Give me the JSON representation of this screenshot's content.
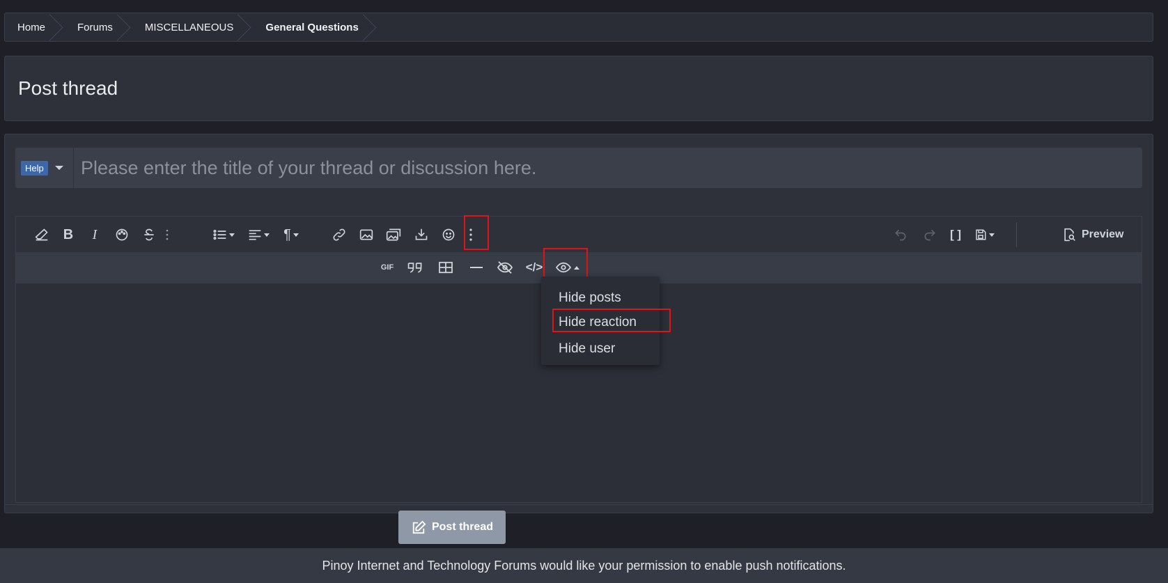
{
  "breadcrumb": {
    "items": [
      {
        "label": "Home"
      },
      {
        "label": "Forums"
      },
      {
        "label": "MISCELLANEOUS"
      },
      {
        "label": "General Questions"
      }
    ]
  },
  "page": {
    "title": "Post thread"
  },
  "thread_form": {
    "prefix_label": "Help",
    "title_placeholder": "Please enter the title of your thread or discussion here.",
    "title_value": ""
  },
  "editor": {
    "toolbar_row1": [
      {
        "icon": "eraser-icon"
      },
      {
        "icon": "bold-icon",
        "glyph": "B"
      },
      {
        "icon": "italic-icon",
        "glyph": "I"
      },
      {
        "icon": "palette-icon"
      },
      {
        "icon": "strikethrough-icon"
      },
      {
        "icon": "more-vertical-icon"
      },
      {
        "icon": "list-icon"
      },
      {
        "icon": "align-icon"
      },
      {
        "icon": "paragraph-icon",
        "glyph": "¶"
      },
      {
        "icon": "link-icon"
      },
      {
        "icon": "image-icon"
      },
      {
        "icon": "media-icon"
      },
      {
        "icon": "insert-icon"
      },
      {
        "icon": "smiley-icon"
      },
      {
        "icon": "more-options-icon"
      }
    ],
    "toolbar_right": [
      {
        "icon": "undo-icon"
      },
      {
        "icon": "redo-icon"
      },
      {
        "icon": "bbcode-toggle-icon",
        "glyph": "[ ]"
      },
      {
        "icon": "drafts-icon"
      }
    ],
    "preview_label": "Preview",
    "toolbar_row2": [
      {
        "icon": "gif-icon",
        "glyph": "GIF"
      },
      {
        "icon": "quote-icon"
      },
      {
        "icon": "table-icon"
      },
      {
        "icon": "horizontal-line-icon"
      },
      {
        "icon": "spoiler-icon"
      },
      {
        "icon": "code-icon",
        "glyph": "</>"
      },
      {
        "icon": "hide-eye-icon"
      }
    ]
  },
  "hide_menu": {
    "items": [
      {
        "label": "Hide posts"
      },
      {
        "label": "Hide reaction"
      },
      {
        "label": "Hide user"
      }
    ]
  },
  "actions": {
    "submit_label": "Post thread"
  },
  "notification": {
    "text": "Pinoy Internet and Technology Forums would like your permission to enable push notifications."
  },
  "colors": {
    "background": "#1f2027",
    "panel": "#2e313a",
    "highlight": "#e01414",
    "prefix_badge": "#3d67a8",
    "submit_button": "#8f98a6"
  }
}
